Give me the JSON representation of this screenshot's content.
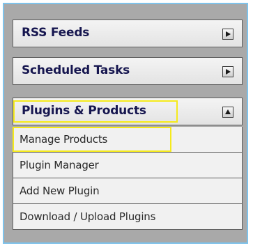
{
  "colors": {
    "frame_border": "#7ec2ea",
    "panel_background": "#a9a9a9",
    "header_text": "#16164f",
    "item_background": "#f1f1f1",
    "highlight": "#f5ea1b"
  },
  "sections": [
    {
      "label": "RSS Feeds",
      "state": "collapsed",
      "toggle_icon": "triangle-right-icon"
    },
    {
      "label": "Scheduled Tasks",
      "state": "collapsed",
      "toggle_icon": "triangle-right-icon"
    },
    {
      "label": "Plugins & Products",
      "state": "expanded",
      "toggle_icon": "triangle-up-icon",
      "highlighted": true
    }
  ],
  "submenu": [
    {
      "label": "Manage Products",
      "highlighted": true
    },
    {
      "label": "Plugin Manager"
    },
    {
      "label": "Add New Plugin"
    },
    {
      "label": "Download / Upload Plugins"
    }
  ]
}
